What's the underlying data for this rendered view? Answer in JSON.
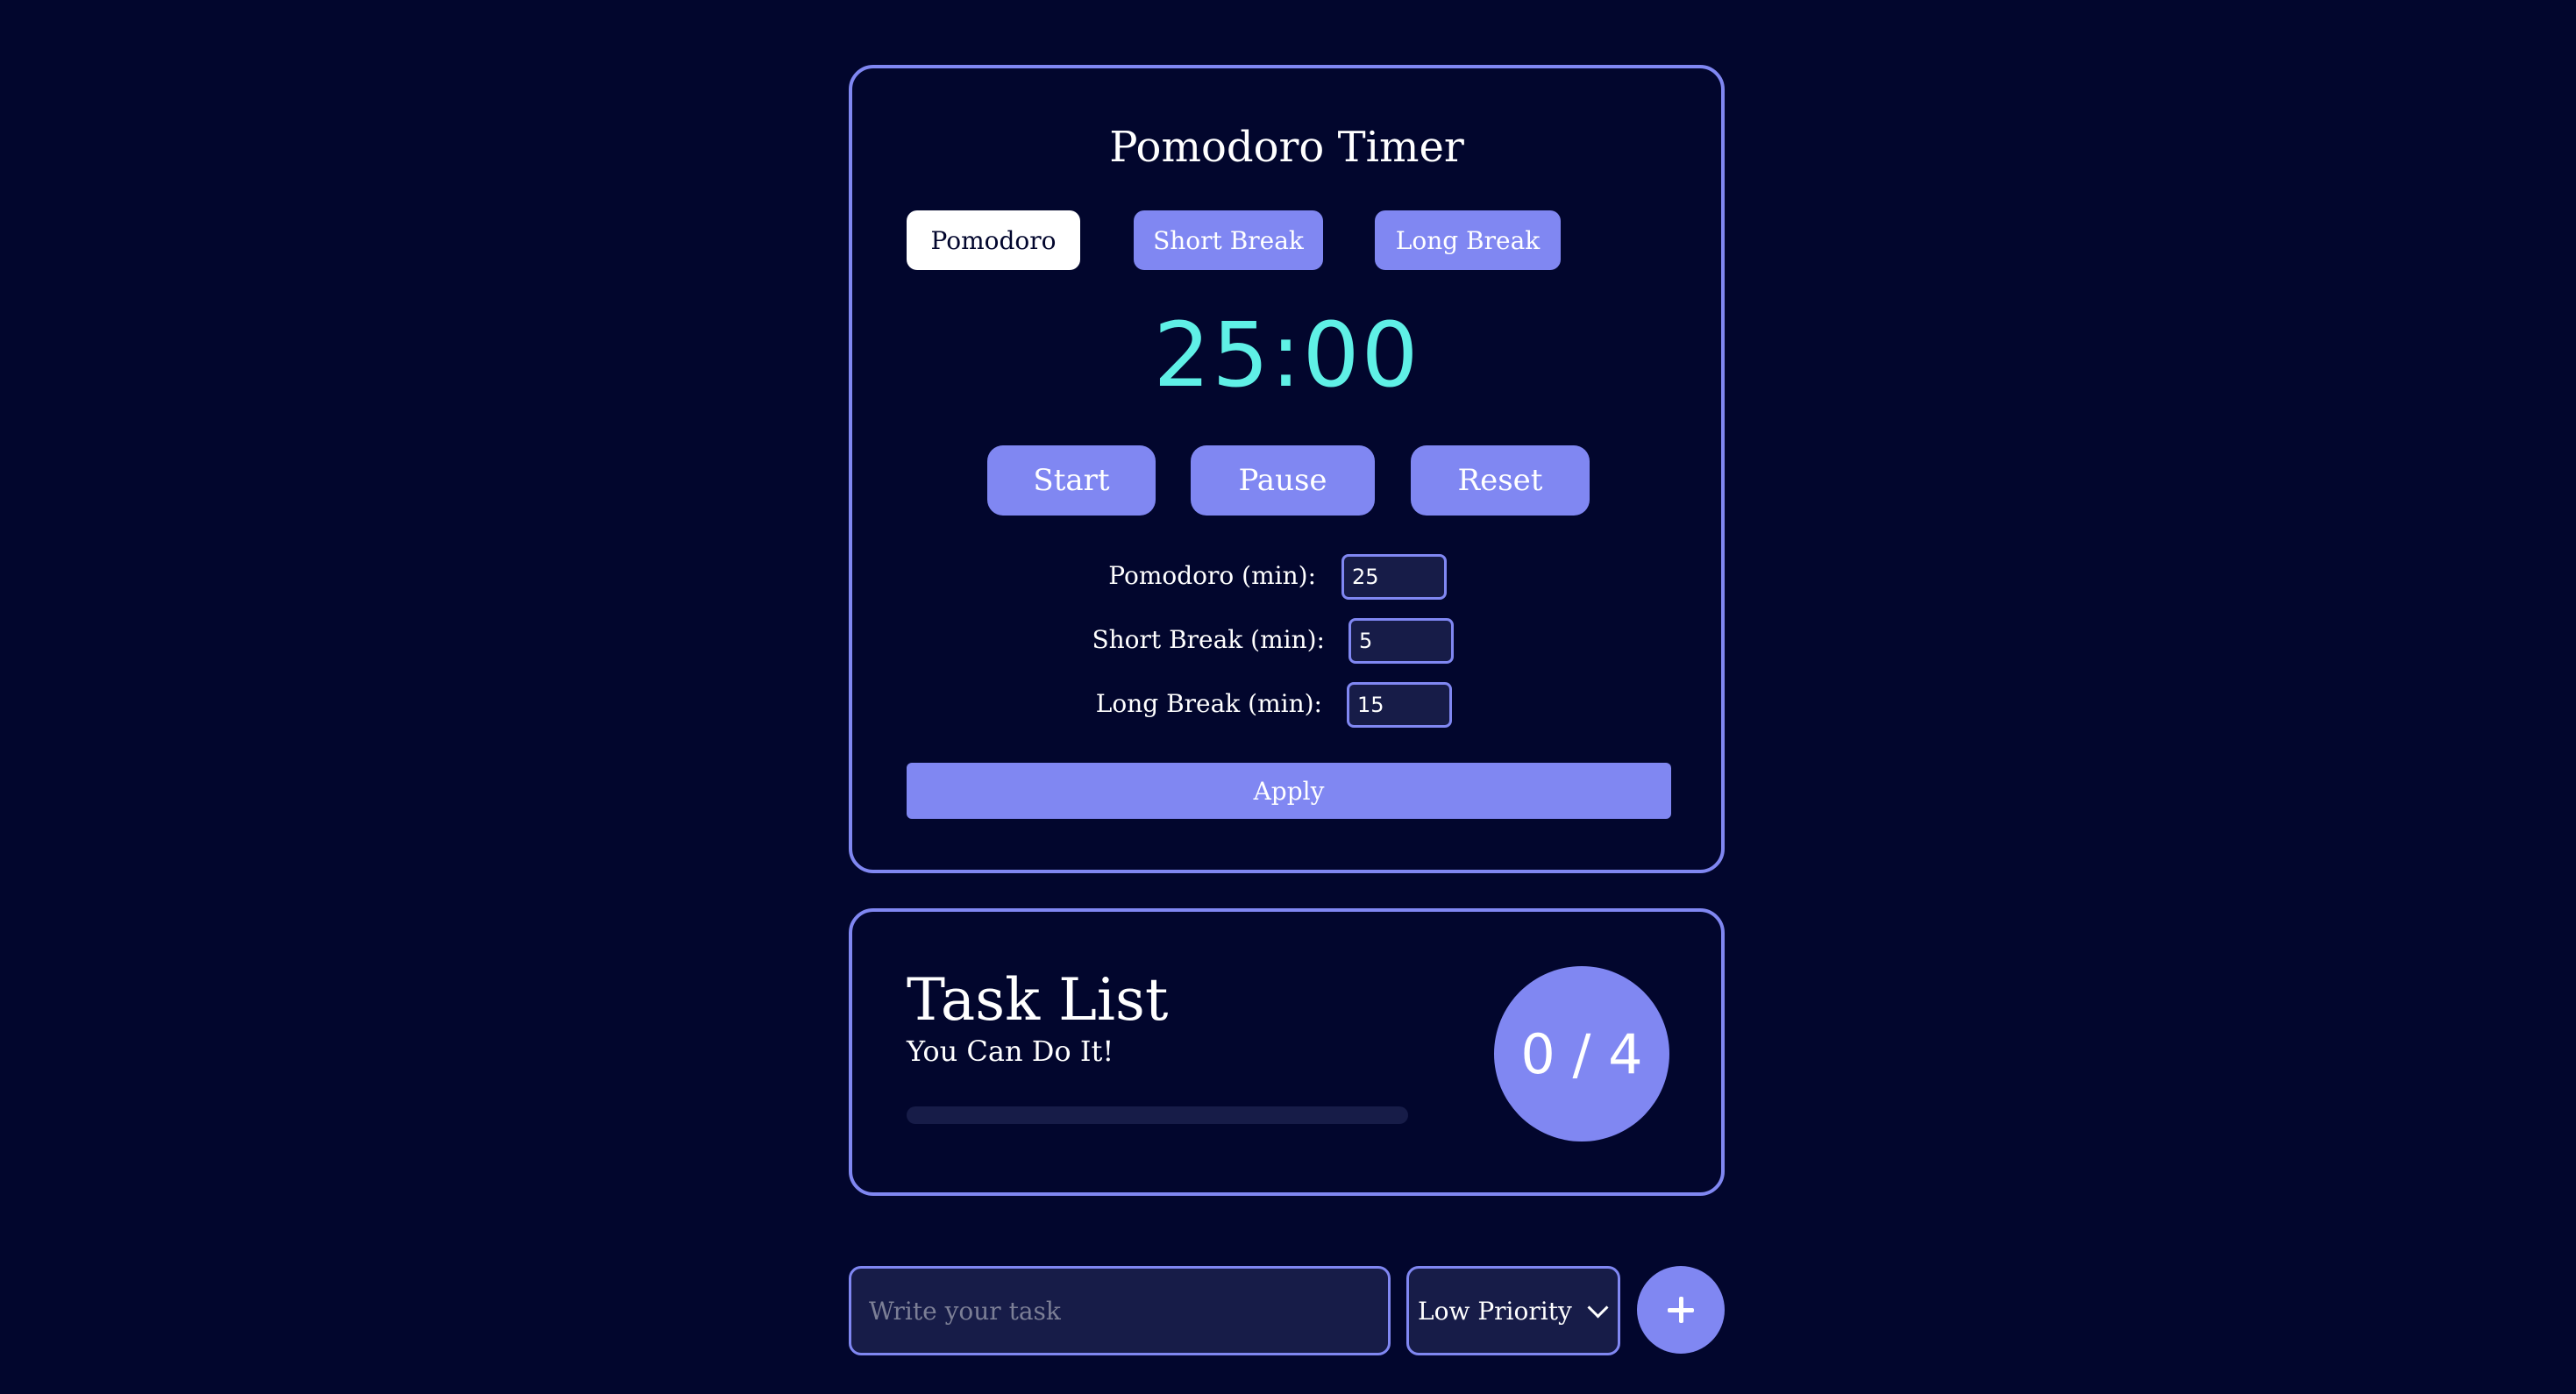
{
  "timer": {
    "title": "Pomodoro Timer",
    "modes": {
      "pomodoro": "Pomodoro",
      "short_break": "Short Break",
      "long_break": "Long Break",
      "active": "pomodoro"
    },
    "time": "25:00",
    "controls": {
      "start": "Start",
      "pause": "Pause",
      "reset": "Reset"
    },
    "settings": {
      "pomodoro_label": "Pomodoro (min):",
      "pomodoro_value": "25",
      "short_label": "Short Break (min):",
      "short_value": "5",
      "long_label": "Long Break (min):",
      "long_value": "15",
      "apply": "Apply"
    }
  },
  "tasks": {
    "title": "Task List",
    "subtitle": "You Can Do It!",
    "completed": 0,
    "total": 4,
    "count_text": "0 / 4",
    "progress_fraction": 0
  },
  "new_task": {
    "placeholder": "Write your task",
    "priority_selected": "Low Priority",
    "add_icon": "plus-icon"
  },
  "colors": {
    "background": "#02062d",
    "accent": "#8087f2",
    "timer_digits": "#5ff0e6",
    "input_bg": "#171c48"
  }
}
